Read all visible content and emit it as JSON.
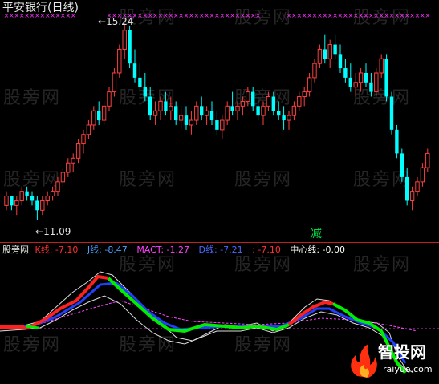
{
  "chart_title": "平安银行(日线)",
  "price_pane": {
    "high_label": "15.24",
    "low_label": "11.09",
    "signal_text": "减",
    "candles": [
      [
        11.4,
        11.7,
        11.3,
        11.6
      ],
      [
        11.6,
        11.6,
        11.3,
        11.4
      ],
      [
        11.4,
        11.6,
        11.2,
        11.5
      ],
      [
        11.5,
        11.8,
        11.4,
        11.7
      ],
      [
        11.7,
        11.8,
        11.5,
        11.6
      ],
      [
        11.6,
        11.7,
        11.4,
        11.5
      ],
      [
        11.5,
        11.6,
        11.1,
        11.3
      ],
      [
        11.3,
        11.6,
        11.2,
        11.5
      ],
      [
        11.5,
        11.7,
        11.4,
        11.6
      ],
      [
        11.6,
        11.8,
        11.5,
        11.7
      ],
      [
        11.7,
        12.0,
        11.6,
        11.9
      ],
      [
        11.9,
        12.2,
        11.8,
        12.1
      ],
      [
        12.1,
        12.4,
        12.0,
        12.3
      ],
      [
        12.3,
        12.5,
        12.1,
        12.4
      ],
      [
        12.4,
        12.8,
        12.3,
        12.7
      ],
      [
        12.7,
        13.0,
        12.5,
        12.9
      ],
      [
        12.9,
        13.2,
        12.8,
        13.1
      ],
      [
        13.1,
        13.5,
        13.0,
        13.4
      ],
      [
        13.4,
        13.6,
        13.1,
        13.2
      ],
      [
        13.2,
        13.6,
        13.1,
        13.5
      ],
      [
        13.5,
        13.9,
        13.4,
        13.8
      ],
      [
        13.8,
        14.3,
        13.7,
        14.2
      ],
      [
        14.2,
        14.8,
        14.1,
        14.7
      ],
      [
        14.7,
        15.24,
        14.5,
        15.1
      ],
      [
        15.1,
        15.2,
        14.3,
        14.4
      ],
      [
        14.4,
        14.7,
        14.0,
        14.1
      ],
      [
        14.1,
        14.4,
        13.8,
        13.9
      ],
      [
        13.9,
        14.2,
        13.6,
        13.7
      ],
      [
        13.7,
        13.9,
        13.2,
        13.3
      ],
      [
        13.3,
        13.6,
        13.1,
        13.4
      ],
      [
        13.4,
        13.7,
        13.2,
        13.6
      ],
      [
        13.6,
        13.8,
        13.3,
        13.4
      ],
      [
        13.4,
        13.7,
        13.2,
        13.5
      ],
      [
        13.5,
        13.6,
        13.1,
        13.2
      ],
      [
        13.2,
        13.5,
        13.0,
        13.3
      ],
      [
        13.3,
        13.5,
        13.0,
        13.1
      ],
      [
        13.1,
        13.4,
        12.9,
        13.2
      ],
      [
        13.2,
        13.6,
        13.1,
        13.5
      ],
      [
        13.5,
        13.7,
        13.2,
        13.3
      ],
      [
        13.3,
        13.5,
        13.1,
        13.4
      ],
      [
        13.4,
        13.6,
        13.1,
        13.2
      ],
      [
        13.2,
        13.4,
        12.9,
        13.0
      ],
      [
        13.0,
        13.3,
        12.8,
        13.2
      ],
      [
        13.2,
        13.6,
        13.1,
        13.5
      ],
      [
        13.5,
        13.8,
        13.3,
        13.4
      ],
      [
        13.4,
        13.6,
        13.2,
        13.5
      ],
      [
        13.5,
        13.7,
        13.3,
        13.6
      ],
      [
        13.6,
        13.9,
        13.5,
        13.8
      ],
      [
        13.8,
        13.9,
        13.4,
        13.5
      ],
      [
        13.5,
        13.7,
        13.2,
        13.3
      ],
      [
        13.3,
        13.6,
        13.1,
        13.5
      ],
      [
        13.5,
        13.8,
        13.4,
        13.7
      ],
      [
        13.7,
        13.8,
        13.3,
        13.4
      ],
      [
        13.4,
        13.6,
        13.2,
        13.3
      ],
      [
        13.3,
        13.5,
        13.0,
        13.2
      ],
      [
        13.2,
        13.4,
        13.0,
        13.3
      ],
      [
        13.3,
        13.6,
        13.2,
        13.5
      ],
      [
        13.5,
        13.8,
        13.4,
        13.7
      ],
      [
        13.7,
        13.9,
        13.5,
        13.8
      ],
      [
        13.8,
        14.2,
        13.7,
        14.1
      ],
      [
        14.1,
        14.5,
        14.0,
        14.4
      ],
      [
        14.4,
        14.8,
        14.3,
        14.7
      ],
      [
        14.7,
        15.0,
        14.4,
        14.5
      ],
      [
        14.5,
        14.9,
        14.3,
        14.8
      ],
      [
        14.8,
        15.0,
        14.5,
        14.6
      ],
      [
        14.6,
        14.8,
        14.2,
        14.3
      ],
      [
        14.3,
        14.5,
        14.0,
        14.1
      ],
      [
        14.1,
        14.4,
        13.8,
        13.9
      ],
      [
        13.9,
        14.2,
        13.7,
        14.0
      ],
      [
        14.0,
        14.3,
        13.8,
        14.2
      ],
      [
        14.2,
        14.4,
        13.9,
        14.0
      ],
      [
        14.0,
        14.2,
        13.7,
        13.8
      ],
      [
        13.8,
        14.3,
        13.7,
        14.2
      ],
      [
        14.2,
        14.6,
        14.1,
        14.5
      ],
      [
        14.5,
        14.6,
        13.6,
        13.7
      ],
      [
        13.7,
        13.8,
        12.9,
        13.0
      ],
      [
        13.0,
        13.1,
        12.4,
        12.5
      ],
      [
        12.5,
        12.6,
        11.9,
        12.0
      ],
      [
        12.0,
        12.2,
        11.4,
        11.5
      ],
      [
        11.5,
        11.8,
        11.3,
        11.7
      ],
      [
        11.7,
        12.0,
        11.6,
        11.9
      ],
      [
        11.9,
        12.3,
        11.8,
        12.2
      ],
      [
        12.2,
        12.6,
        12.1,
        12.5
      ]
    ]
  },
  "indicator_pane": {
    "pane_name": "股旁网",
    "legend": [
      {
        "label": "K线",
        "value": "-7.10",
        "color": "#ff3030"
      },
      {
        "label": "J线",
        "value": "-8.47",
        "color": "#4aa0ff"
      },
      {
        "label": "MACT",
        "value": "-1.27",
        "color": "#ff40ff"
      },
      {
        "label": "D线",
        "value": "-7.21",
        "color": "#4a6aff"
      },
      {
        "label": "",
        "value": "-7.10",
        "color": "#ff3030"
      },
      {
        "label": "中心线",
        "value": "-0.00",
        "color": "#ffffff"
      }
    ]
  },
  "watermark_text": "股旁网",
  "logo": {
    "brand": "智投网",
    "url_text": "raiyue.com"
  },
  "colors": {
    "up": "#ff4040",
    "down": "#00ffff",
    "signal": "#00cc44",
    "k_line": "#ff2020",
    "d_line": "#2040ff",
    "green_line": "#00ee00",
    "ma_line": "#ff40ff",
    "envelope": "#dddddd",
    "cross_marks": "#ff30ff"
  }
}
